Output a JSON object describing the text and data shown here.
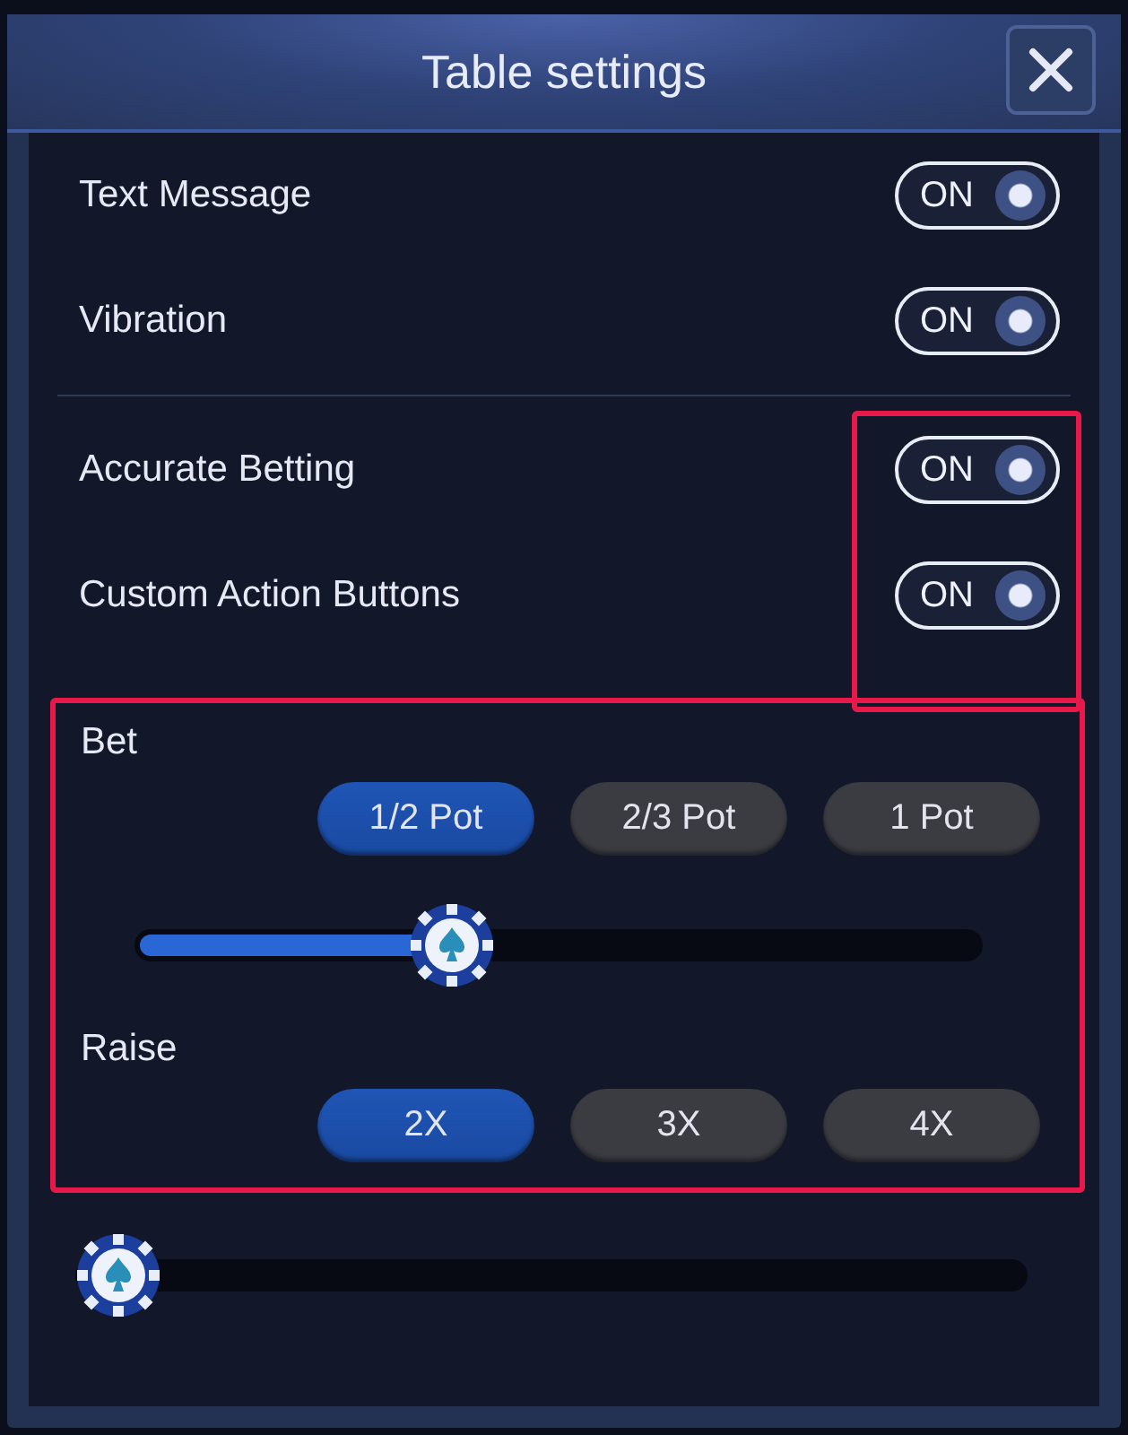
{
  "window": {
    "title": "Table settings"
  },
  "toggle_groups": [
    {
      "highlight": false,
      "items": [
        {
          "label": "Text Message",
          "on": true,
          "state_label": "ON"
        },
        {
          "label": "Vibration",
          "on": true,
          "state_label": "ON"
        }
      ]
    },
    {
      "highlight": true,
      "items": [
        {
          "label": "Accurate Betting",
          "on": true,
          "state_label": "ON"
        },
        {
          "label": "Custom Action Buttons",
          "on": true,
          "state_label": "ON"
        }
      ]
    }
  ],
  "bet_raise": {
    "highlight": true,
    "bet": {
      "label": "Bet",
      "options": [
        {
          "label": "1/2 Pot",
          "selected": true
        },
        {
          "label": "2/3 Pot",
          "selected": false
        },
        {
          "label": "1 Pot",
          "selected": false
        }
      ],
      "level": 0.36
    },
    "raise": {
      "label": "Raise",
      "options": [
        {
          "label": "2X",
          "selected": true
        },
        {
          "label": "3X",
          "selected": false
        },
        {
          "label": "4X",
          "selected": false
        }
      ],
      "level": 0
    }
  }
}
